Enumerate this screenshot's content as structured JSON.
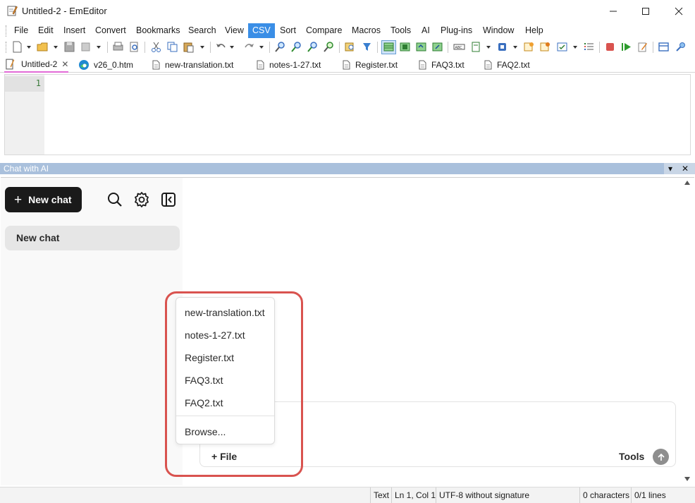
{
  "window": {
    "title": "Untitled-2 - EmEditor"
  },
  "menu": {
    "items": [
      "File",
      "Edit",
      "Insert",
      "Convert",
      "Bookmarks",
      "Search",
      "View",
      "CSV",
      "Sort",
      "Compare",
      "Macros",
      "Tools",
      "AI",
      "Plug-ins",
      "Window",
      "Help"
    ],
    "active": "CSV"
  },
  "tabs": [
    {
      "label": "Untitled-2",
      "active": true
    },
    {
      "label": "v26_0.htm"
    },
    {
      "label": "new-translation.txt"
    },
    {
      "label": "notes-1-27.txt"
    },
    {
      "label": "Register.txt"
    },
    {
      "label": "FAQ3.txt"
    },
    {
      "label": "FAQ2.txt"
    }
  ],
  "editor": {
    "line_number": "1"
  },
  "chat_panel": {
    "title": "Chat with AI",
    "new_chat_button": "New chat",
    "chat_history": [
      "New chat"
    ],
    "file_button": "File",
    "tools_label": "Tools",
    "file_menu": {
      "items": [
        "new-translation.txt",
        "notes-1-27.txt",
        "Register.txt",
        "FAQ3.txt",
        "FAQ2.txt"
      ],
      "browse": "Browse..."
    }
  },
  "status": {
    "mode": "Text",
    "position": "Ln 1, Col 1",
    "encoding": "UTF-8 without signature",
    "characters": "0 characters",
    "lines": "0/1 lines"
  },
  "colors": {
    "accent": "#3a8ee6",
    "highlight_outline": "#d9534f",
    "active_tab_underline": "#e26bd7"
  }
}
